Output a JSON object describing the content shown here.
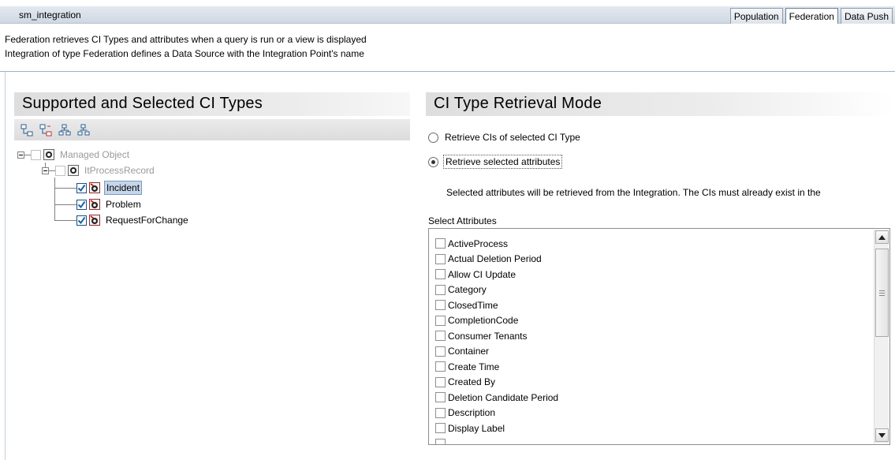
{
  "header": {
    "title": "sm_integration",
    "tabs": [
      {
        "label": "Population",
        "active": false
      },
      {
        "label": "Federation",
        "active": true
      },
      {
        "label": "Data Push",
        "active": false
      }
    ]
  },
  "description": {
    "line1": "Federation retrieves CI Types and attributes when a query is run or a view is displayed",
    "line2": "Integration of type Federation defines a Data Source with the Integration Point's name"
  },
  "left_panel": {
    "title": "Supported and Selected CI Types",
    "toolbar": [
      "expand-all-icon",
      "collapse-all-icon",
      "select-all-icon",
      "deselect-all-icon"
    ],
    "tree": [
      {
        "label": "Managed Object",
        "checked": false,
        "disabled": true
      },
      {
        "label": "ItProcessRecord",
        "checked": false,
        "disabled": true
      },
      {
        "label": "Incident",
        "checked": true,
        "selected": true
      },
      {
        "label": "Problem",
        "checked": true
      },
      {
        "label": "RequestForChange",
        "checked": true
      }
    ]
  },
  "right_panel": {
    "title": "CI Type Retrieval Mode",
    "radio_cis": "Retrieve CIs of selected CI Type",
    "radio_attrs": "Retrieve selected attributes",
    "selected_mode": "attributes",
    "info": "Selected attributes will be retrieved from the Integration. The CIs must already exist in the",
    "select_label": "Select Attributes",
    "attributes": [
      "ActiveProcess",
      "Actual Deletion Period",
      "Allow CI Update",
      "Category",
      "ClosedTime",
      "CompletionCode",
      "Consumer Tenants",
      "Container",
      "Create Time",
      "Created By",
      "Deletion Candidate Period",
      "Description",
      "Display Label"
    ]
  },
  "colors": {
    "accent": "#1c5180",
    "selection": "#c6d6ea",
    "header_bg": "#cfd8e3"
  }
}
